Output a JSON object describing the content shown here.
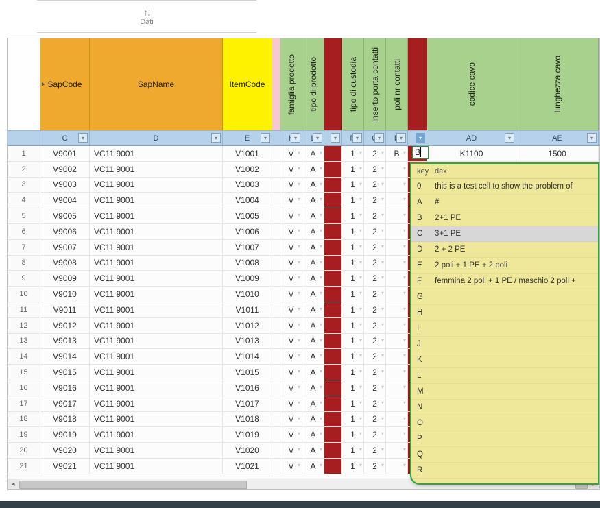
{
  "toolbar": {
    "sort_glyph": "↑↓",
    "sort_label": "Dati"
  },
  "group_headers": {
    "sapcode": "SapCode",
    "sapname": "SapName",
    "itemcode": "ItemCode",
    "famiglia": "famiglia prodotto",
    "tipoprod": "tipo di prodotto",
    "tipocust": "tipo di custodia",
    "inserto": "inserto porta contatti",
    "polinr": "poli nr contatti",
    "codice": "codice cavo",
    "lunghezza": "lunghezza cavo"
  },
  "col_letters": {
    "c": "C",
    "d": "D",
    "e": "E",
    "k": "K",
    "l": "L",
    "n": "N",
    "o": "O",
    "p": "P",
    "ad": "AD",
    "ae": "AE"
  },
  "first_row_extra": {
    "ad": "K1100",
    "ae": "1500"
  },
  "rows": [
    {
      "n": "1",
      "c": "V9001",
      "d": "VC11 9001",
      "e": "V1001",
      "k": "V",
      "l": "A",
      "nn": "1",
      "o": "2",
      "p": "B"
    },
    {
      "n": "2",
      "c": "V9002",
      "d": "VC11 9001",
      "e": "V1002",
      "k": "V",
      "l": "A",
      "nn": "1",
      "o": "2",
      "p": ""
    },
    {
      "n": "3",
      "c": "V9003",
      "d": "VC11 9001",
      "e": "V1003",
      "k": "V",
      "l": "A",
      "nn": "1",
      "o": "2",
      "p": ""
    },
    {
      "n": "4",
      "c": "V9004",
      "d": "VC11 9001",
      "e": "V1004",
      "k": "V",
      "l": "A",
      "nn": "1",
      "o": "2",
      "p": ""
    },
    {
      "n": "5",
      "c": "V9005",
      "d": "VC11 9001",
      "e": "V1005",
      "k": "V",
      "l": "A",
      "nn": "1",
      "o": "2",
      "p": ""
    },
    {
      "n": "6",
      "c": "V9006",
      "d": "VC11 9001",
      "e": "V1006",
      "k": "V",
      "l": "A",
      "nn": "1",
      "o": "2",
      "p": ""
    },
    {
      "n": "7",
      "c": "V9007",
      "d": "VC11 9001",
      "e": "V1007",
      "k": "V",
      "l": "A",
      "nn": "1",
      "o": "2",
      "p": ""
    },
    {
      "n": "8",
      "c": "V9008",
      "d": "VC11 9001",
      "e": "V1008",
      "k": "V",
      "l": "A",
      "nn": "1",
      "o": "2",
      "p": ""
    },
    {
      "n": "9",
      "c": "V9009",
      "d": "VC11 9001",
      "e": "V1009",
      "k": "V",
      "l": "A",
      "nn": "1",
      "o": "2",
      "p": ""
    },
    {
      "n": "10",
      "c": "V9010",
      "d": "VC11 9001",
      "e": "V1010",
      "k": "V",
      "l": "A",
      "nn": "1",
      "o": "2",
      "p": ""
    },
    {
      "n": "11",
      "c": "V9011",
      "d": "VC11 9001",
      "e": "V1011",
      "k": "V",
      "l": "A",
      "nn": "1",
      "o": "2",
      "p": ""
    },
    {
      "n": "12",
      "c": "V9012",
      "d": "VC11 9001",
      "e": "V1012",
      "k": "V",
      "l": "A",
      "nn": "1",
      "o": "2",
      "p": ""
    },
    {
      "n": "13",
      "c": "V9013",
      "d": "VC11 9001",
      "e": "V1013",
      "k": "V",
      "l": "A",
      "nn": "1",
      "o": "2",
      "p": ""
    },
    {
      "n": "14",
      "c": "V9014",
      "d": "VC11 9001",
      "e": "V1014",
      "k": "V",
      "l": "A",
      "nn": "1",
      "o": "2",
      "p": ""
    },
    {
      "n": "15",
      "c": "V9015",
      "d": "VC11 9001",
      "e": "V1015",
      "k": "V",
      "l": "A",
      "nn": "1",
      "o": "2",
      "p": ""
    },
    {
      "n": "16",
      "c": "V9016",
      "d": "VC11 9001",
      "e": "V1016",
      "k": "V",
      "l": "A",
      "nn": "1",
      "o": "2",
      "p": ""
    },
    {
      "n": "17",
      "c": "V9017",
      "d": "VC11 9001",
      "e": "V1017",
      "k": "V",
      "l": "A",
      "nn": "1",
      "o": "2",
      "p": ""
    },
    {
      "n": "18",
      "c": "V9018",
      "d": "VC11 9001",
      "e": "V1018",
      "k": "V",
      "l": "A",
      "nn": "1",
      "o": "2",
      "p": ""
    },
    {
      "n": "19",
      "c": "V9019",
      "d": "VC11 9001",
      "e": "V1019",
      "k": "V",
      "l": "A",
      "nn": "1",
      "o": "2",
      "p": ""
    },
    {
      "n": "20",
      "c": "V9020",
      "d": "VC11 9001",
      "e": "V1020",
      "k": "V",
      "l": "A",
      "nn": "1",
      "o": "2",
      "p": ""
    },
    {
      "n": "21",
      "c": "V9021",
      "d": "VC11 9001",
      "e": "V1021",
      "k": "V",
      "l": "A",
      "nn": "1",
      "o": "2",
      "p": ""
    }
  ],
  "editing": {
    "value": "B"
  },
  "dropdown": {
    "head_key": "key",
    "head_dex": "dex",
    "items": [
      {
        "k": "0",
        "d": "this is a test cell to show the problem of"
      },
      {
        "k": "A",
        "d": "#"
      },
      {
        "k": "B",
        "d": "2+1 PE"
      },
      {
        "k": "C",
        "d": "3+1 PE"
      },
      {
        "k": "D",
        "d": "2 + 2 PE"
      },
      {
        "k": "E",
        "d": "2 poli + 1 PE + 2 poli"
      },
      {
        "k": "F",
        "d": "femmina 2 poli + 1 PE / maschio 2 poli +"
      },
      {
        "k": "G",
        "d": ""
      },
      {
        "k": "H",
        "d": ""
      },
      {
        "k": "I",
        "d": ""
      },
      {
        "k": "J",
        "d": ""
      },
      {
        "k": "K",
        "d": ""
      },
      {
        "k": "L",
        "d": ""
      },
      {
        "k": "M",
        "d": ""
      },
      {
        "k": "N",
        "d": ""
      },
      {
        "k": "O",
        "d": ""
      },
      {
        "k": "P",
        "d": ""
      },
      {
        "k": "Q",
        "d": ""
      },
      {
        "k": "R",
        "d": ""
      }
    ],
    "selected_index": 3
  }
}
